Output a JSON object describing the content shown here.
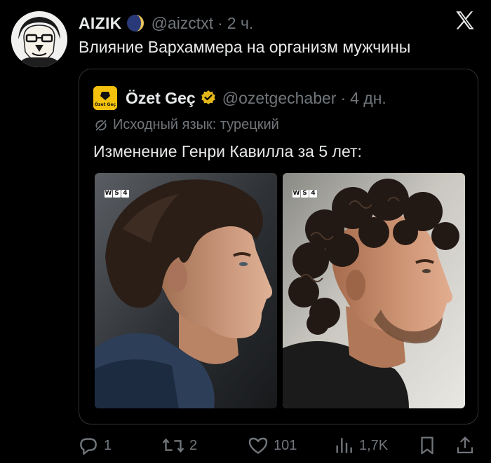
{
  "tweet": {
    "author_name": "AIZIK",
    "handle": "@aizctxt",
    "separator": "·",
    "time": "2 ч.",
    "text": "Влияние Вархаммера на организм мужчины"
  },
  "quote": {
    "author_name": "Özet Geç",
    "avatar_label": "Özet Geç",
    "handle": "@ozetgechaber",
    "separator": "·",
    "time": "4 дн.",
    "translation_note": "Исходный язык: турецкий",
    "text": "Изменение Генри Кавилла за 5 лет:",
    "media": [
      {
        "badge": [
          "W",
          "S",
          "4"
        ]
      },
      {
        "badge": [
          "W",
          "S",
          "4"
        ]
      }
    ]
  },
  "actions": {
    "replies": "1",
    "reposts": "2",
    "likes": "101",
    "views": "1,7K"
  },
  "colors": {
    "background": "#000000",
    "text": "#e7e9ea",
    "muted": "#71767b",
    "border": "#2f3336",
    "verified_gold": "#e2b719",
    "quote_avatar_yellow": "#f4c20d"
  },
  "icons": [
    "moon-icon",
    "x-logo-icon",
    "verified-badge-icon",
    "translate-icon",
    "reply-icon",
    "repost-icon",
    "like-icon",
    "views-icon",
    "bookmark-icon",
    "share-icon"
  ]
}
